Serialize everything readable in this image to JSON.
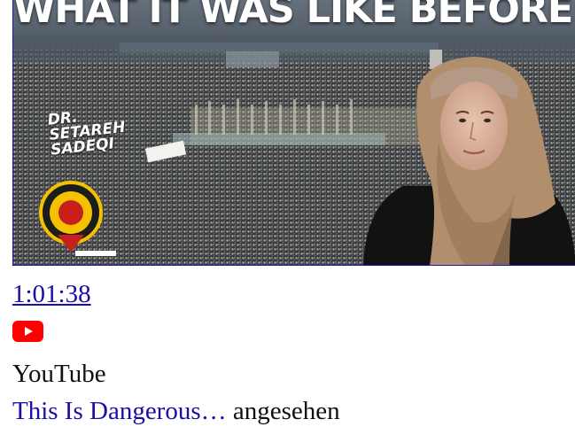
{
  "thumbnail": {
    "headline": "WHAT IT WAS LIKE BEFORE”",
    "name_lines": [
      "DR.",
      "SETAREH",
      "SADEQI"
    ]
  },
  "video": {
    "duration": "1:01:38",
    "source_icon": "youtube-icon",
    "source_name": "YouTube",
    "title_truncated": "This Is Dangerous…",
    "status": " angesehen"
  },
  "colors": {
    "link": "#1a0dab",
    "youtube_red": "#ff0000",
    "thumb_border": "#1a1ab0"
  }
}
